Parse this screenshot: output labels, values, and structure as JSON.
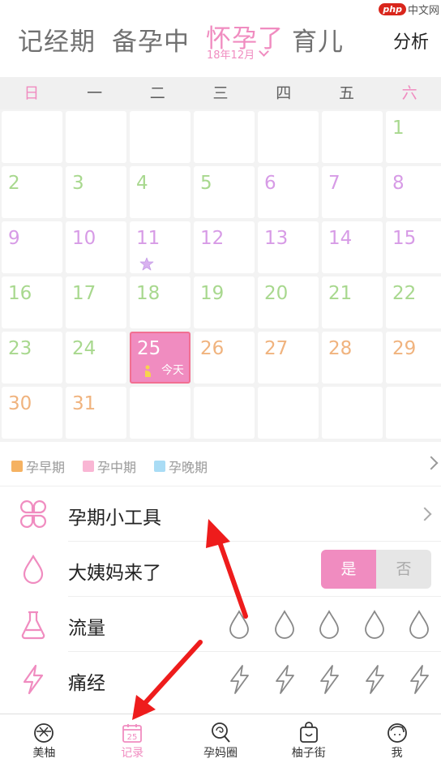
{
  "header": {
    "tabs": [
      {
        "label": "记经期"
      },
      {
        "label": "备孕中"
      },
      {
        "label": "怀孕了",
        "sub": "18年12月"
      },
      {
        "label": "育儿"
      }
    ],
    "analyze": "分析",
    "watermark_logo": "php",
    "watermark_text": "中文网"
  },
  "weekdays": [
    "日",
    "一",
    "二",
    "三",
    "四",
    "五",
    "六"
  ],
  "calendar": {
    "today_label": "今天",
    "days": [
      {
        "d": "1",
        "c": "green"
      },
      {
        "d": "2",
        "c": "green"
      },
      {
        "d": "3",
        "c": "green"
      },
      {
        "d": "4",
        "c": "green"
      },
      {
        "d": "5",
        "c": "green"
      },
      {
        "d": "6",
        "c": "purple"
      },
      {
        "d": "7",
        "c": "purple"
      },
      {
        "d": "8",
        "c": "purple"
      },
      {
        "d": "9",
        "c": "purple"
      },
      {
        "d": "10",
        "c": "purple"
      },
      {
        "d": "11",
        "c": "purple"
      },
      {
        "d": "12",
        "c": "purple"
      },
      {
        "d": "13",
        "c": "purple"
      },
      {
        "d": "14",
        "c": "purple"
      },
      {
        "d": "15",
        "c": "purple"
      },
      {
        "d": "16",
        "c": "green"
      },
      {
        "d": "17",
        "c": "green"
      },
      {
        "d": "18",
        "c": "green"
      },
      {
        "d": "19",
        "c": "green"
      },
      {
        "d": "20",
        "c": "green"
      },
      {
        "d": "21",
        "c": "green"
      },
      {
        "d": "22",
        "c": "green"
      },
      {
        "d": "23",
        "c": "green"
      },
      {
        "d": "24",
        "c": "green"
      },
      {
        "d": "25",
        "c": "today"
      },
      {
        "d": "26",
        "c": "orange"
      },
      {
        "d": "27",
        "c": "orange"
      },
      {
        "d": "28",
        "c": "orange"
      },
      {
        "d": "29",
        "c": "orange"
      },
      {
        "d": "30",
        "c": "orange"
      },
      {
        "d": "31",
        "c": "orange"
      }
    ]
  },
  "legend": {
    "items": [
      {
        "label": "孕早期",
        "color": "#f5b262"
      },
      {
        "label": "孕中期",
        "color": "#f9b6d4"
      },
      {
        "label": "孕晚期",
        "color": "#a9dcf5"
      }
    ]
  },
  "rows": {
    "tools": {
      "label": "孕期小工具"
    },
    "period": {
      "label": "大姨妈来了",
      "yes": "是",
      "no": "否"
    },
    "flow": {
      "label": "流量"
    },
    "cramps": {
      "label": "痛经"
    }
  },
  "nav": {
    "items": [
      {
        "label": "美柚"
      },
      {
        "label": "记录",
        "icon_text": "25"
      },
      {
        "label": "孕妈圈"
      },
      {
        "label": "柚子街"
      },
      {
        "label": "我"
      }
    ]
  },
  "colors": {
    "accent_pink": "#f08cc0",
    "green_day": "#a8d88e",
    "purple_day": "#d79be6",
    "orange_day": "#f0b37e",
    "annotation_red": "#ee1c1c"
  }
}
